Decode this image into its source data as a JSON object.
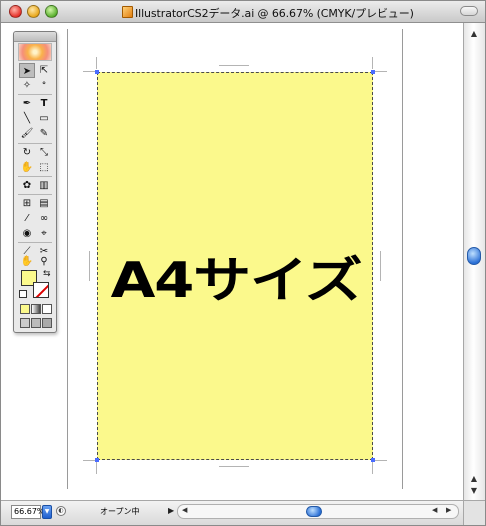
{
  "window": {
    "title": "IllustratorCS2データ.ai @ 66.67% (CMYK/プレビュー)"
  },
  "document": {
    "artboard_text": "A4サイズ",
    "paper_color": "#fbf98c"
  },
  "toolbox": {
    "tools": [
      "selection-tool",
      "direct-selection-tool",
      "magic-wand-tool",
      "lasso-tool",
      "pen-tool",
      "type-tool",
      "line-segment-tool",
      "rectangle-tool",
      "paintbrush-tool",
      "pencil-tool",
      "rotate-tool",
      "scale-tool",
      "warp-tool",
      "free-transform-tool",
      "symbol-sprayer-tool",
      "column-graph-tool",
      "mesh-tool",
      "gradient-tool",
      "eyedropper-tool",
      "blend-tool",
      "live-paint-bucket-tool",
      "live-paint-selection-tool",
      "slice-tool",
      "scissors-tool",
      "hand-tool",
      "zoom-tool"
    ],
    "fill_color": "#fbf98c",
    "stroke": "none"
  },
  "status": {
    "zoom": "66.67%",
    "state_text": "オープン中"
  }
}
